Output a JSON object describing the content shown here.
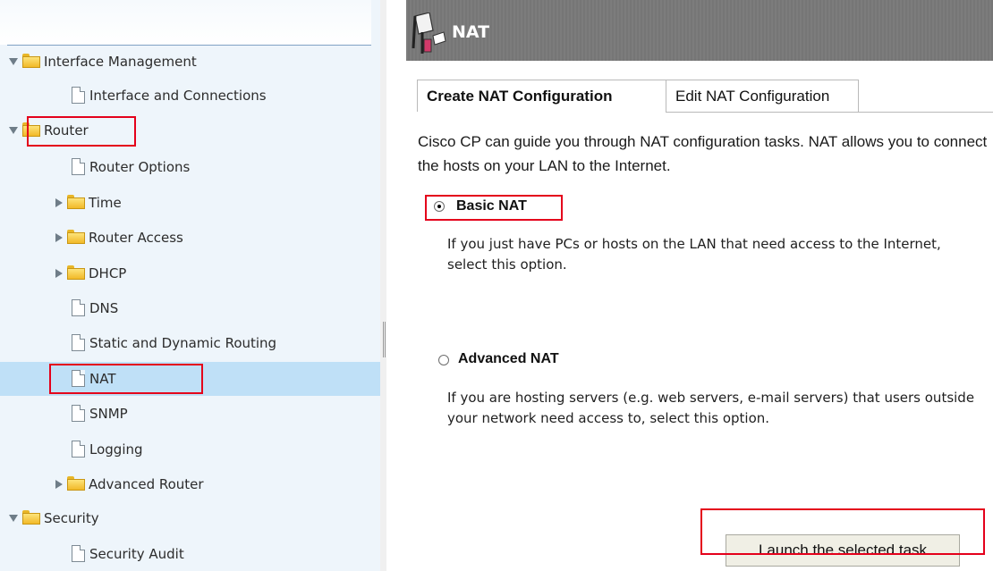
{
  "tree": {
    "items": [
      {
        "label": "Interface Management",
        "type": "folder",
        "expanded": true
      },
      {
        "label": "Interface and Connections",
        "type": "page"
      },
      {
        "label": "Router",
        "type": "folder",
        "expanded": true
      },
      {
        "label": "Router Options",
        "type": "page"
      },
      {
        "label": "Time",
        "type": "folder",
        "expanded": false
      },
      {
        "label": "Router Access",
        "type": "folder",
        "expanded": false
      },
      {
        "label": "DHCP",
        "type": "folder",
        "expanded": false
      },
      {
        "label": "DNS",
        "type": "page"
      },
      {
        "label": "Static and Dynamic Routing",
        "type": "page"
      },
      {
        "label": "NAT",
        "type": "page",
        "selected": true
      },
      {
        "label": "SNMP",
        "type": "page"
      },
      {
        "label": "Logging",
        "type": "page"
      },
      {
        "label": "Advanced Router",
        "type": "folder",
        "expanded": false
      },
      {
        "label": "Security",
        "type": "folder",
        "expanded": true
      },
      {
        "label": "Security Audit",
        "type": "page"
      }
    ]
  },
  "header": {
    "title": "NAT",
    "icon": "nat-icon"
  },
  "tabs": [
    {
      "label": "Create NAT Configuration",
      "active": true
    },
    {
      "label": "Edit NAT Configuration",
      "active": false
    }
  ],
  "content": {
    "intro": "Cisco CP can guide you through NAT configuration tasks. NAT allows you to connect the hosts on your LAN to the Internet.",
    "options": [
      {
        "label": "Basic NAT",
        "selected": true,
        "description": "If you just have PCs or hosts on the LAN that need access to the Internet, select this option."
      },
      {
        "label": "Advanced NAT",
        "selected": false,
        "description": "If you are hosting servers (e.g. web servers, e-mail servers) that users outside your network need access to, select this option."
      }
    ],
    "launch_label": "Launch the selected task"
  },
  "colors": {
    "highlight": "#e4001b",
    "selected_row": "#bfe0f7",
    "header_bg": "#7a7a7a"
  }
}
